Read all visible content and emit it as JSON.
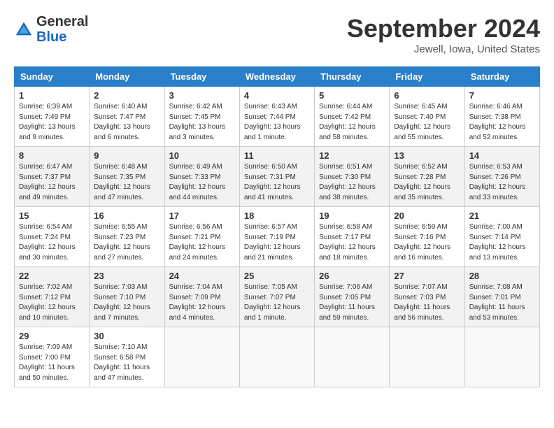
{
  "header": {
    "logo": {
      "general": "General",
      "blue": "Blue"
    },
    "title": "September 2024",
    "location": "Jewell, Iowa, United States"
  },
  "calendar": {
    "days_of_week": [
      "Sunday",
      "Monday",
      "Tuesday",
      "Wednesday",
      "Thursday",
      "Friday",
      "Saturday"
    ],
    "weeks": [
      [
        {
          "day": "1",
          "sunrise": "6:39 AM",
          "sunset": "7:49 PM",
          "daylight": "13 hours and 9 minutes."
        },
        {
          "day": "2",
          "sunrise": "6:40 AM",
          "sunset": "7:47 PM",
          "daylight": "13 hours and 6 minutes."
        },
        {
          "day": "3",
          "sunrise": "6:42 AM",
          "sunset": "7:45 PM",
          "daylight": "13 hours and 3 minutes."
        },
        {
          "day": "4",
          "sunrise": "6:43 AM",
          "sunset": "7:44 PM",
          "daylight": "13 hours and 1 minute."
        },
        {
          "day": "5",
          "sunrise": "6:44 AM",
          "sunset": "7:42 PM",
          "daylight": "12 hours and 58 minutes."
        },
        {
          "day": "6",
          "sunrise": "6:45 AM",
          "sunset": "7:40 PM",
          "daylight": "12 hours and 55 minutes."
        },
        {
          "day": "7",
          "sunrise": "6:46 AM",
          "sunset": "7:38 PM",
          "daylight": "12 hours and 52 minutes."
        }
      ],
      [
        {
          "day": "8",
          "sunrise": "6:47 AM",
          "sunset": "7:37 PM",
          "daylight": "12 hours and 49 minutes."
        },
        {
          "day": "9",
          "sunrise": "6:48 AM",
          "sunset": "7:35 PM",
          "daylight": "12 hours and 47 minutes."
        },
        {
          "day": "10",
          "sunrise": "6:49 AM",
          "sunset": "7:33 PM",
          "daylight": "12 hours and 44 minutes."
        },
        {
          "day": "11",
          "sunrise": "6:50 AM",
          "sunset": "7:31 PM",
          "daylight": "12 hours and 41 minutes."
        },
        {
          "day": "12",
          "sunrise": "6:51 AM",
          "sunset": "7:30 PM",
          "daylight": "12 hours and 38 minutes."
        },
        {
          "day": "13",
          "sunrise": "6:52 AM",
          "sunset": "7:28 PM",
          "daylight": "12 hours and 35 minutes."
        },
        {
          "day": "14",
          "sunrise": "6:53 AM",
          "sunset": "7:26 PM",
          "daylight": "12 hours and 33 minutes."
        }
      ],
      [
        {
          "day": "15",
          "sunrise": "6:54 AM",
          "sunset": "7:24 PM",
          "daylight": "12 hours and 30 minutes."
        },
        {
          "day": "16",
          "sunrise": "6:55 AM",
          "sunset": "7:23 PM",
          "daylight": "12 hours and 27 minutes."
        },
        {
          "day": "17",
          "sunrise": "6:56 AM",
          "sunset": "7:21 PM",
          "daylight": "12 hours and 24 minutes."
        },
        {
          "day": "18",
          "sunrise": "6:57 AM",
          "sunset": "7:19 PM",
          "daylight": "12 hours and 21 minutes."
        },
        {
          "day": "19",
          "sunrise": "6:58 AM",
          "sunset": "7:17 PM",
          "daylight": "12 hours and 18 minutes."
        },
        {
          "day": "20",
          "sunrise": "6:59 AM",
          "sunset": "7:16 PM",
          "daylight": "12 hours and 16 minutes."
        },
        {
          "day": "21",
          "sunrise": "7:00 AM",
          "sunset": "7:14 PM",
          "daylight": "12 hours and 13 minutes."
        }
      ],
      [
        {
          "day": "22",
          "sunrise": "7:02 AM",
          "sunset": "7:12 PM",
          "daylight": "12 hours and 10 minutes."
        },
        {
          "day": "23",
          "sunrise": "7:03 AM",
          "sunset": "7:10 PM",
          "daylight": "12 hours and 7 minutes."
        },
        {
          "day": "24",
          "sunrise": "7:04 AM",
          "sunset": "7:09 PM",
          "daylight": "12 hours and 4 minutes."
        },
        {
          "day": "25",
          "sunrise": "7:05 AM",
          "sunset": "7:07 PM",
          "daylight": "12 hours and 1 minute."
        },
        {
          "day": "26",
          "sunrise": "7:06 AM",
          "sunset": "7:05 PM",
          "daylight": "11 hours and 59 minutes."
        },
        {
          "day": "27",
          "sunrise": "7:07 AM",
          "sunset": "7:03 PM",
          "daylight": "11 hours and 56 minutes."
        },
        {
          "day": "28",
          "sunrise": "7:08 AM",
          "sunset": "7:01 PM",
          "daylight": "11 hours and 53 minutes."
        }
      ],
      [
        {
          "day": "29",
          "sunrise": "7:09 AM",
          "sunset": "7:00 PM",
          "daylight": "11 hours and 50 minutes."
        },
        {
          "day": "30",
          "sunrise": "7:10 AM",
          "sunset": "6:58 PM",
          "daylight": "11 hours and 47 minutes."
        },
        null,
        null,
        null,
        null,
        null
      ]
    ]
  }
}
